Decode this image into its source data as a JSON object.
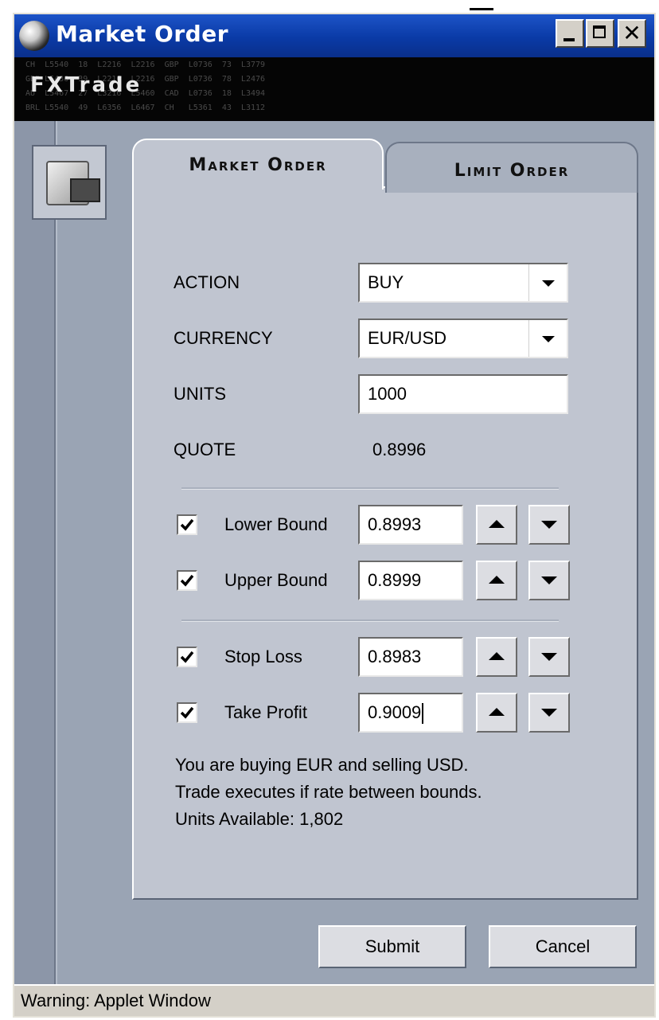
{
  "window": {
    "title": "Market Order",
    "brand": "FXTrade",
    "status_bar": "Warning: Applet Window"
  },
  "banner_ticker": [
    "CH  L5540  18  L2216  L2216  GBP  L0736  73  L3779",
    "GBP L5436  39  L2216  L2216  GBP  L0736  78  L2476",
    "AU  L5467  27  L3216  L5460  CAD  L0736  18  L3494",
    "BRL L5540  49  L6356  L6467  CH   L5361  43  L3112"
  ],
  "tabs": [
    {
      "label": "Market Order",
      "active": true
    },
    {
      "label": "Limit Order",
      "active": false
    }
  ],
  "form": {
    "action": {
      "label": "ACTION",
      "value": "BUY"
    },
    "currency": {
      "label": "CURRENCY",
      "value": "EUR/USD"
    },
    "units": {
      "label": "UNITS",
      "value": "1000"
    },
    "quote": {
      "label": "QUOTE",
      "value": "0.8996"
    }
  },
  "bounds": {
    "lower": {
      "label": "Lower Bound",
      "value": "0.8993",
      "checked": true
    },
    "upper": {
      "label": "Upper Bound",
      "value": "0.8999",
      "checked": true
    }
  },
  "protect": {
    "stop_loss": {
      "label": "Stop Loss",
      "value": "0.8983",
      "checked": true
    },
    "take_profit": {
      "label": "Take Profit",
      "value": "0.9009",
      "checked": true
    }
  },
  "info_lines": [
    "You are buying EUR and selling USD.",
    "Trade executes if rate between bounds.",
    "Units Available: 1,802"
  ],
  "buttons": {
    "submit": "Submit",
    "cancel": "Cancel"
  }
}
